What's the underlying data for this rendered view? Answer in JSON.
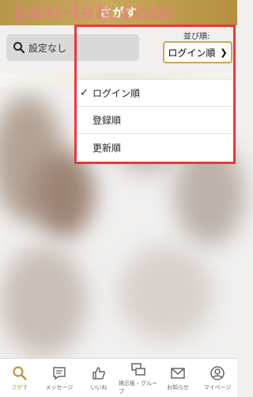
{
  "header": {
    "title": "さがす",
    "watermark": "pon-lab.com"
  },
  "search": {
    "icon": "search-icon",
    "text": "設定なし"
  },
  "sort": {
    "label": "並び順:",
    "selected": "ログイン順",
    "options": [
      {
        "label": "ログイン順",
        "checked": true
      },
      {
        "label": "登録順",
        "checked": false
      },
      {
        "label": "更新順",
        "checked": false
      }
    ],
    "check_mark": "✓"
  },
  "tabbar": {
    "items": [
      {
        "label": "さがす",
        "icon": "search-icon",
        "active": true
      },
      {
        "label": "メッセージ",
        "icon": "message-icon",
        "active": false
      },
      {
        "label": "いいね",
        "icon": "like-icon",
        "active": false
      },
      {
        "label": "掲示板・グループ",
        "icon": "board-icon",
        "active": false
      },
      {
        "label": "お知らせ",
        "icon": "mail-icon",
        "active": false
      },
      {
        "label": "マイページ",
        "icon": "user-icon",
        "active": false
      }
    ]
  },
  "colors": {
    "accent": "#c9a95d",
    "highlight": "#e53a3a",
    "active_tab": "#b9973f"
  }
}
